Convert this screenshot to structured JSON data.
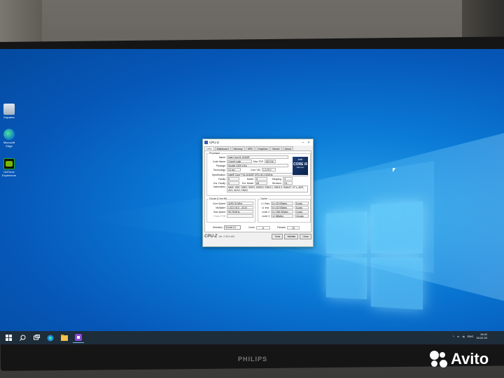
{
  "desktop": {
    "icons": [
      {
        "label": "Корзина"
      },
      {
        "label": "Microsoft Edge"
      },
      {
        "label": "GeForce Experience"
      }
    ]
  },
  "cpuz": {
    "title": "CPU-Z",
    "tabs": [
      "CPU",
      "Mainboard",
      "Memory",
      "SPD",
      "Graphics",
      "Bench",
      "About"
    ],
    "processor": {
      "group_title": "Processor",
      "name_label": "Name",
      "name": "Intel Core i5 10400F",
      "code_name_label": "Code Name",
      "code_name": "Comet Lake",
      "max_tdp_label": "Max TDP",
      "max_tdp": "65.0 W",
      "package_label": "Package",
      "package": "Socket 1200 LGA",
      "technology_label": "Technology",
      "technology": "14 nm",
      "core_vid_label": "Core VID",
      "core_vid": "1.179 V",
      "spec_label": "Specification",
      "spec": "Intel® Core™ i5-10400F CPU @ 2.90GHz",
      "family_label": "Family",
      "family": "6",
      "model_label": "Model",
      "model": "5",
      "stepping_label": "Stepping",
      "stepping": "3",
      "ext_family_label": "Ext. Family",
      "ext_family": "6",
      "ext_model_label": "Ext. Model",
      "ext_model": "A5",
      "revision_label": "Revision",
      "revision": "G1",
      "instructions_label": "Instructions",
      "instructions": "MMX, SSE, SSE2, SSE3, SSSE3, SSE4.1, SSE4.2, EM64T, VT-x, AES, AVX, AVX2, FMA3"
    },
    "logo": {
      "brand": "intel",
      "line": "CORE i5",
      "sub": "10th Gen"
    },
    "clocks": {
      "group_title": "Clocks (Core #0)",
      "core_speed_label": "Core Speed",
      "core_speed": "4190.76 MHz",
      "multiplier_label": "Multiplier",
      "multiplier": "x 42.0 (8.0 - 43.0)",
      "bus_speed_label": "Bus Speed",
      "bus_speed": "99.78 MHz",
      "rated_fsb_label": "Rated FSB"
    },
    "cache": {
      "group_title": "Cache",
      "l1d_label": "L1 Data",
      "l1d": "6 x 32 KBytes",
      "l1d_way": "8-way",
      "l1i_label": "L1 Inst.",
      "l1i": "6 x 32 KBytes",
      "l1i_way": "8-way",
      "l2_label": "Level 2",
      "l2": "6 x 256 KBytes",
      "l2_way": "4-way",
      "l3_label": "Level 3",
      "l3": "12 MBytes",
      "l3_way": "16-way"
    },
    "selection_label": "Selection",
    "selection": "Socket #1",
    "cores_label": "Cores",
    "cores": "6",
    "threads_label": "Threads",
    "threads": "12",
    "brand": "CPU-Z",
    "version": "Ver. 2.05.0.x64",
    "tools_label": "Tools",
    "validate_label": "Validate",
    "close_label": "Close"
  },
  "taskbar": {
    "time": "16:42",
    "date": "18.02.20",
    "lang": "ENG"
  },
  "monitor_brand": "PHILIPS",
  "watermark": "Avito"
}
